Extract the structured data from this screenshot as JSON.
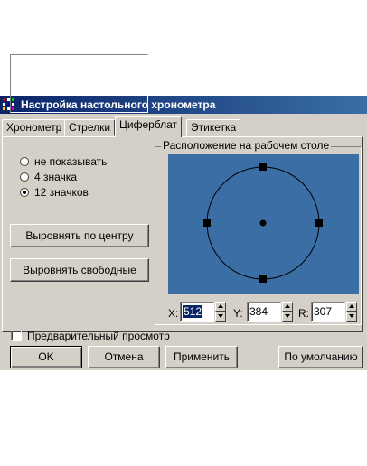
{
  "window": {
    "title": "Настройка настольного хронометра"
  },
  "tabs": [
    {
      "label": "Хронометр"
    },
    {
      "label": "Стрелки"
    },
    {
      "label": "Циферблат",
      "active": true
    },
    {
      "label": "Этикетка"
    }
  ],
  "marks_group": {
    "options": [
      {
        "label": "не показывать",
        "checked": false
      },
      {
        "label": "4 значка",
        "checked": false
      },
      {
        "label": "12 значков",
        "checked": true
      }
    ]
  },
  "actions": {
    "center_label": "Выровнять по центру",
    "free_label": "Выровнять свободные"
  },
  "desktop": {
    "legend": "Расположение на рабочем столе",
    "background_color": "#3a6ea5"
  },
  "coords": {
    "x_label": "X:",
    "x_value": "512",
    "y_label": "Y:",
    "y_value": "384",
    "r_label": "R:",
    "r_value": "307"
  },
  "preview": {
    "label": "Предварительный просмотр",
    "checked": false
  },
  "buttons": {
    "ok": "OK",
    "cancel": "Отмена",
    "apply": "Применить",
    "default": "По умолчанию"
  }
}
